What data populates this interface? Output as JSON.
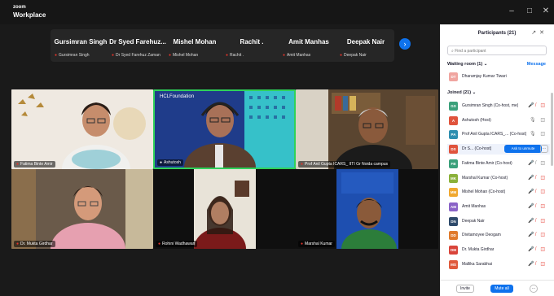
{
  "app": {
    "brand_top": "zoom",
    "brand_bottom": "Workplace"
  },
  "window": {
    "minimize": "–",
    "maximize": "□",
    "close": "✕"
  },
  "strip": {
    "tiles": [
      {
        "name": "Gursimran Singh",
        "label": "Gursimran Singh"
      },
      {
        "name": "Dr Syed Farehuz...",
        "label": "Dr Syed Farehuz Zaman"
      },
      {
        "name": "Mishel Mohan",
        "label": "Mishel Mohan"
      },
      {
        "name": "Rachit .",
        "label": "Rachit ."
      },
      {
        "name": "Amit Manhas",
        "label": "Amit Manhas"
      },
      {
        "name": "Deepak Nair",
        "label": "Deepak Nair"
      }
    ],
    "next_icon": "›"
  },
  "videos": [
    {
      "label": "Fatima Binte Amir"
    },
    {
      "label": "Ashutosh",
      "banner": "HCLFoundation"
    },
    {
      "label": "Prof Anil Gupta ICARS_ IITI Gr Noida campus"
    },
    {
      "label": "Dr. Mukta Girdhar"
    },
    {
      "label": "Rohini Wadhawan"
    },
    {
      "label": "Marshal Kumar"
    }
  ],
  "panel": {
    "title": "Participants (21)",
    "icons": [
      "↗",
      "✕"
    ],
    "search_placeholder": "Find a participant",
    "waiting_label": "Waiting room (1)",
    "waiting_chevron": "⌄",
    "message_label": "Message",
    "waiting_person": {
      "initials": "DT",
      "name": "Dharamjay Kumar Tiwari",
      "color": "#f0a5a0"
    },
    "joined_label": "Joined (21)",
    "joined_chevron": "⌄",
    "participants": [
      {
        "initials": "GS",
        "name": "Gursimran Singh (Co-host, me)",
        "color": "#3aa07a",
        "status": "🎤̸ ◫"
      },
      {
        "initials": "A",
        "name": "Ashutosh (Host)",
        "color": "#e0533c",
        "status": "🎙 ◫",
        "grey": true
      },
      {
        "initials": "PA",
        "name": "Prof Anil Gupta ICARS_... (Co-host)",
        "color": "#2f8fb0",
        "status": "🎙 ◫",
        "grey": true
      },
      {
        "initials": "DS",
        "name": "Dr S... (Co-host)",
        "color": "#e0533c",
        "ask": "Ask to unmute",
        "more": "···",
        "highlight": true
      },
      {
        "initials": "FB",
        "name": "Fatima Binte Amir (Co-host)",
        "color": "#3aa07a",
        "status": "🎤̸ ◫",
        "grey": true
      },
      {
        "initials": "MK",
        "name": "Marshal Kumar (Co-host)",
        "color": "#8bb13a",
        "status": "🎤̸ ◫"
      },
      {
        "initials": "MM",
        "name": "Mishel Mohan (Co-host)",
        "color": "#f0a830",
        "status": "🎤̸ ◫"
      },
      {
        "initials": "AM",
        "name": "Amit Manhas",
        "color": "#8a63c7",
        "status": "🎤̸ ◫"
      },
      {
        "initials": "DN",
        "name": "Deepak Nair",
        "color": "#2e4a6b",
        "status": "🎤̸ ◫"
      },
      {
        "initials": "DD",
        "name": "Divitamoyee Deogam",
        "color": "#e07a2c",
        "status": "🎤̸ ◫"
      },
      {
        "initials": "DM",
        "name": "Dr. Mukta Girdhar",
        "color": "#d9443a",
        "status": "🎤̸ ◫"
      },
      {
        "initials": "MS",
        "name": "Mallika Sarabhai",
        "color": "#e05a3c",
        "status": "🎤̸ ◫"
      }
    ],
    "invite_label": "Invite",
    "mute_all_label": "Mute all",
    "more_label": "···"
  }
}
